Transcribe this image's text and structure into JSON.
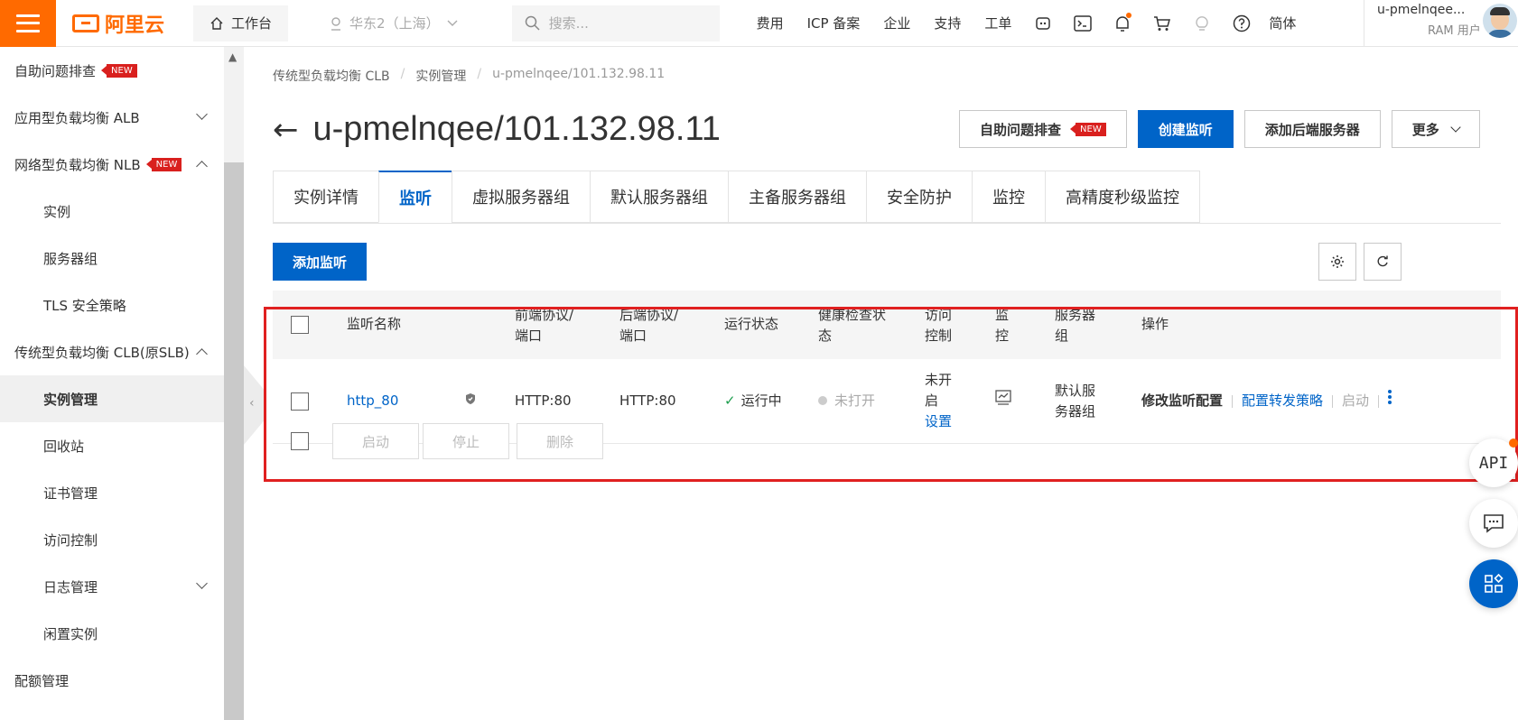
{
  "topbar": {
    "logo": "阿里云",
    "workbench": "工作台",
    "region": "华东2（上海）",
    "search_placeholder": "搜索...",
    "nav": [
      "费用",
      "ICP 备案",
      "企业",
      "支持",
      "工单"
    ],
    "language": "简体",
    "username": "u-pmelnqee...",
    "role": "RAM 用户"
  },
  "sidebar": {
    "items": [
      {
        "label": "自助问题排查",
        "badge": "NEW"
      },
      {
        "label": "应用型负载均衡 ALB"
      },
      {
        "label": "网络型负载均衡 NLB",
        "badge": "NEW"
      },
      {
        "label": "实例"
      },
      {
        "label": "服务器组"
      },
      {
        "label": "TLS 安全策略"
      },
      {
        "label": "传统型负载均衡 CLB(原SLB)"
      },
      {
        "label": "实例管理"
      },
      {
        "label": "回收站"
      },
      {
        "label": "证书管理"
      },
      {
        "label": "访问控制"
      },
      {
        "label": "日志管理"
      },
      {
        "label": "闲置实例"
      },
      {
        "label": "配额管理"
      }
    ]
  },
  "breadcrumb": [
    "传统型负载均衡 CLB",
    "实例管理",
    "u-pmelnqee/101.132.98.11"
  ],
  "page_title": "u-pmelnqee/101.132.98.11",
  "actions": {
    "troubleshoot": "自助问题排查",
    "troubleshoot_badge": "NEW",
    "create_listener": "创建监听",
    "add_backend": "添加后端服务器",
    "more": "更多"
  },
  "tabs": [
    "实例详情",
    "监听",
    "虚拟服务器组",
    "默认服务器组",
    "主备服务器组",
    "安全防护",
    "监控",
    "高精度秒级监控"
  ],
  "add_listener": "添加监听",
  "table": {
    "headers": {
      "name": "监听名称",
      "frontend": [
        "前端协议/",
        "端口"
      ],
      "backend": [
        "后端协议/",
        "端口"
      ],
      "status": "运行状态",
      "health": [
        "健康检查状",
        "态"
      ],
      "acl": [
        "访问",
        "控制"
      ],
      "monitor": [
        "监",
        "控"
      ],
      "server_group": [
        "服务器",
        "组"
      ],
      "ops": "操作"
    },
    "row": {
      "name": "http_80",
      "frontend": "HTTP:80",
      "backend": "HTTP:80",
      "status": "运行中",
      "health": "未打开",
      "acl_status": [
        "未开",
        "启"
      ],
      "acl_link": "设置",
      "server_group": [
        "默认服",
        "务器组"
      ],
      "op_modify": "修改监听配置",
      "op_forward": "配置转发策略",
      "op_start": "启动"
    },
    "batch": [
      "启动",
      "停止",
      "删除"
    ]
  },
  "float": {
    "api": "API"
  },
  "colors": {
    "brand": "#ff6a00",
    "primary": "#0064c8",
    "highlight": "#e02020"
  }
}
